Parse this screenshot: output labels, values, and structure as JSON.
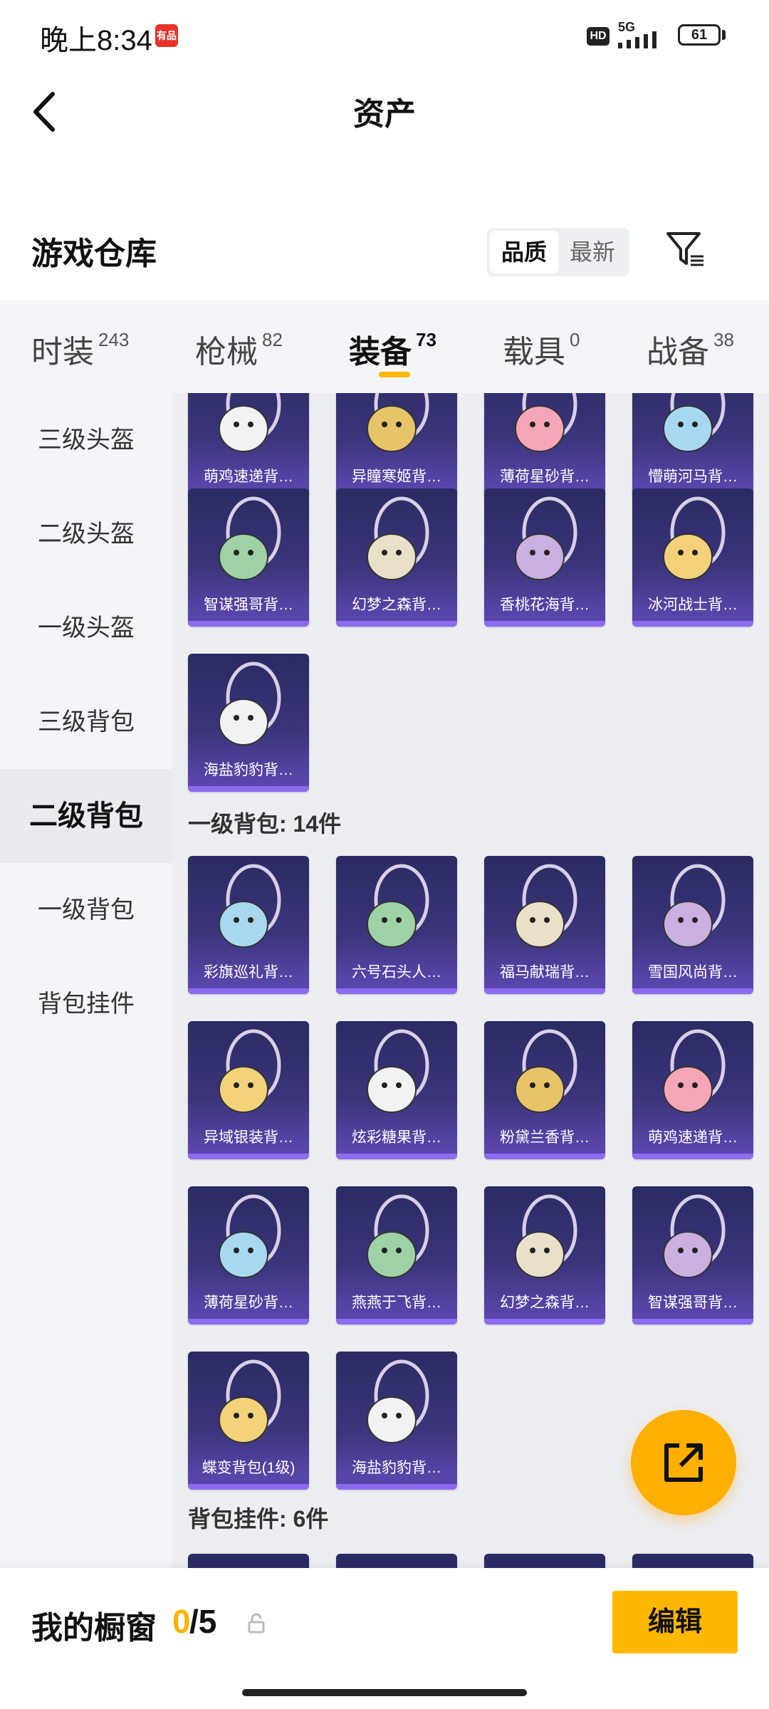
{
  "status_bar": {
    "time": "晚上8:34",
    "app_badge": "有品",
    "hd": "HD",
    "network": "5G",
    "battery": "61"
  },
  "header": {
    "title": "资产",
    "back_icon": "chevron-left-icon"
  },
  "warehouse": {
    "title": "游戏仓库",
    "sort": {
      "active": "品质",
      "inactive": "最新"
    },
    "filter_icon": "filter-icon"
  },
  "tabs": [
    {
      "label": "时装",
      "count": "243"
    },
    {
      "label": "枪械",
      "count": "82"
    },
    {
      "label": "装备",
      "count": "73"
    },
    {
      "label": "载具",
      "count": "0"
    },
    {
      "label": "战备",
      "count": "38"
    }
  ],
  "sidebar": {
    "items": [
      "三级头盔",
      "二级头盔",
      "一级头盔",
      "三级背包",
      "二级背包",
      "一级背包",
      "背包挂件"
    ],
    "active": "二级背包"
  },
  "groups": {
    "level2_items": [
      "萌鸡速递背…",
      "异瞳寒姬背…",
      "薄荷星砂背…",
      "懵萌河马背…",
      "智谋强哥背…",
      "幻梦之森背…",
      "香桃花海背…",
      "冰河战士背…",
      "海盐豹豹背…"
    ],
    "level1_title": "一级背包: 14件",
    "level1_items": [
      "彩旗巡礼背…",
      "六号石头人…",
      "福马献瑞背…",
      "雪国风尚背…",
      "异域银装背…",
      "炫彩糖果背…",
      "粉黛兰香背…",
      "萌鸡速递背…",
      "薄荷星砂背…",
      "燕燕于飞背…",
      "幻梦之森背…",
      "智谋强哥背…",
      "蝶变背包(1级)",
      "海盐豹豹背…"
    ],
    "pendant_title": "背包挂件: 6件"
  },
  "fab": {
    "icon": "share-export-icon"
  },
  "bottom": {
    "label": "我的橱窗",
    "current": "0",
    "max": "/5",
    "lock_icon": "lock-icon",
    "edit": "编辑"
  },
  "colors": {
    "accent": "#ffb800",
    "card_top": "#2a2b63",
    "card_bottom": "#5f4ab4"
  }
}
